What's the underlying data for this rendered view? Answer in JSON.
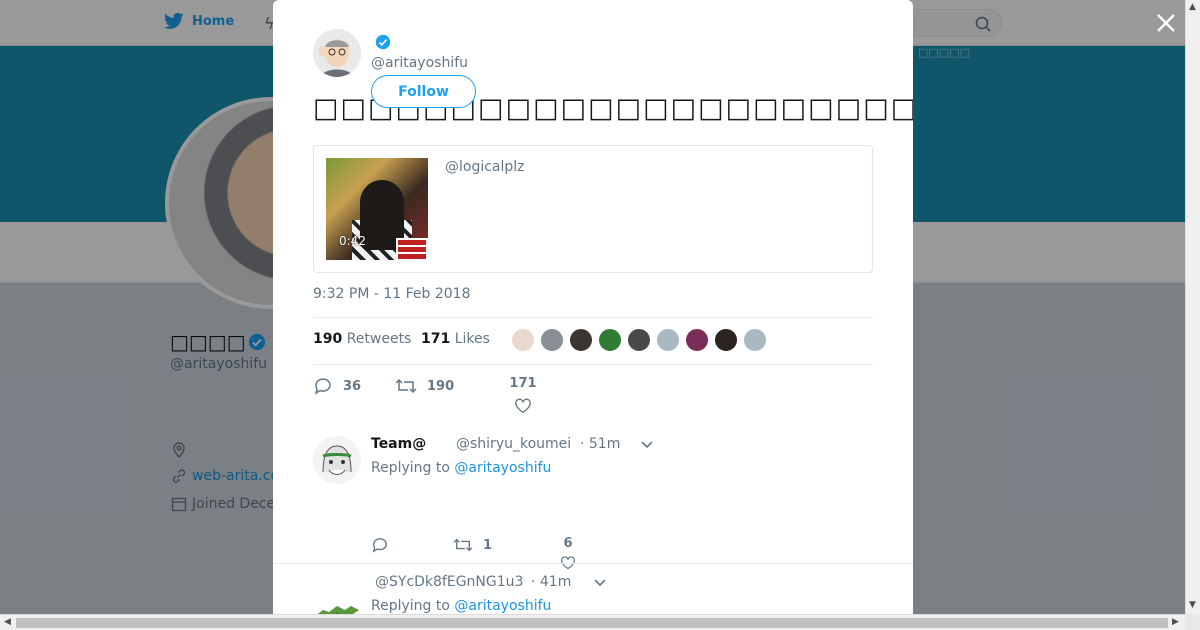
{
  "topbar": {
    "home_label": "Home"
  },
  "profile": {
    "name": "□□□□",
    "handle": "@aritayoshifu",
    "link_text": "web-arita.co",
    "joined_text": "Joined Dece",
    "banner_text": "□□□□□"
  },
  "tweet": {
    "handle": "@aritayoshifu",
    "follow_label": "Follow",
    "text": "□□□□□□□□□□□□□□□□□□□□□□□□□□□□□□□□□□□□□□□□□",
    "quote": {
      "handle": "@logicalplz",
      "video_duration": "0:42"
    },
    "timestamp": "9:32 PM - 11 Feb 2018",
    "retweets_count": "190",
    "retweets_label": "Retweets",
    "likes_count": "171",
    "likes_label": "Likes",
    "liker_colors": [
      "#e8d8d0",
      "#8a8f95",
      "#3a3530",
      "#2f7d32",
      "#4a4a4a",
      "#aab8c2",
      "#7b2d5a",
      "#2b2320",
      "#aab8c2"
    ],
    "actions": {
      "replies": "36",
      "retweets": "190",
      "likes": "171"
    }
  },
  "replies": [
    {
      "name": "Team@",
      "handle": "@shiryu_koumei",
      "time": "· 51m",
      "replying_prefix": "Replying to",
      "replying_to": "@aritayoshifu",
      "actions": {
        "replies": "",
        "retweets": "1",
        "likes": "6"
      }
    },
    {
      "name": "",
      "handle": "@SYcDk8fEGnNG1u3",
      "time": "· 41m",
      "replying_prefix": "Replying to",
      "replying_to": "@aritayoshifu"
    }
  ],
  "colors": {
    "accent": "#1da1f2",
    "link": "#1b95e0",
    "muted": "#657786",
    "banner": "#1a8fb3"
  }
}
